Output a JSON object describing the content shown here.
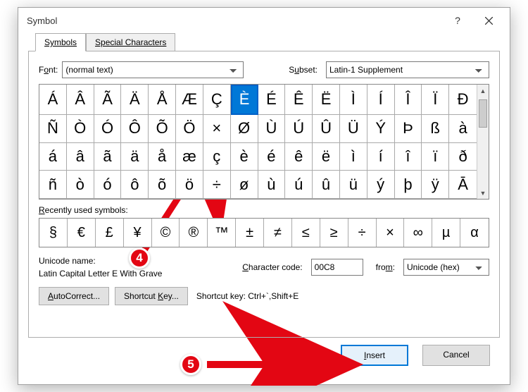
{
  "dialog": {
    "title": "Symbol",
    "help": "?",
    "close": "×"
  },
  "tabs": {
    "symbols": "Symbols",
    "special": "Special Characters"
  },
  "font": {
    "label_pre": "F",
    "label_u": "o",
    "label_post": "nt:",
    "value": "(normal text)"
  },
  "subset": {
    "label_pre": "S",
    "label_u": "u",
    "label_post": "bset:",
    "value": "Latin-1 Supplement"
  },
  "grid_rows": [
    [
      "Á",
      "Â",
      "Ã",
      "Ä",
      "Å",
      "Æ",
      "Ç",
      "È",
      "É",
      "Ê",
      "Ë",
      "Ì",
      "Í",
      "Î",
      "Ï",
      "Ð"
    ],
    [
      "Ñ",
      "Ò",
      "Ó",
      "Ô",
      "Õ",
      "Ö",
      "×",
      "Ø",
      "Ù",
      "Ú",
      "Û",
      "Ü",
      "Ý",
      "Þ",
      "ß",
      "à"
    ],
    [
      "á",
      "â",
      "ã",
      "ä",
      "å",
      "æ",
      "ç",
      "è",
      "é",
      "ê",
      "ë",
      "ì",
      "í",
      "î",
      "ï",
      "ð"
    ],
    [
      "ñ",
      "ò",
      "ó",
      "ô",
      "õ",
      "ö",
      "÷",
      "ø",
      "ù",
      "ú",
      "û",
      "ü",
      "ý",
      "þ",
      "ÿ",
      "Ā"
    ]
  ],
  "selected_index": 7,
  "recently_label_pre": "",
  "recently_label_u": "R",
  "recently_label_post": "ecently used symbols:",
  "recent": [
    "§",
    "€",
    "£",
    "¥",
    "©",
    "®",
    "™",
    "±",
    "≠",
    "≤",
    "≥",
    "÷",
    "×",
    "∞",
    "µ",
    "α"
  ],
  "unicode_name_label": "Unicode name:",
  "unicode_name": "Latin Capital Letter E With Grave",
  "char_code_label_u": "C",
  "char_code_label_post": "haracter code:",
  "char_code": "00C8",
  "from_label_pre": "fro",
  "from_label_u": "m",
  "from_label_post": ":",
  "from_value": "Unicode (hex)",
  "autocorrect_u": "A",
  "autocorrect_post": "utoCorrect...",
  "shortcut_key_btn": "Shortcut ",
  "shortcut_key_btn_u": "K",
  "shortcut_key_btn_post": "ey...",
  "shortcut_text": "Shortcut key: Ctrl+`,Shift+E",
  "insert_u": "I",
  "insert_post": "nsert",
  "cancel": "Cancel",
  "badges": {
    "b4": "4",
    "b5": "5"
  }
}
